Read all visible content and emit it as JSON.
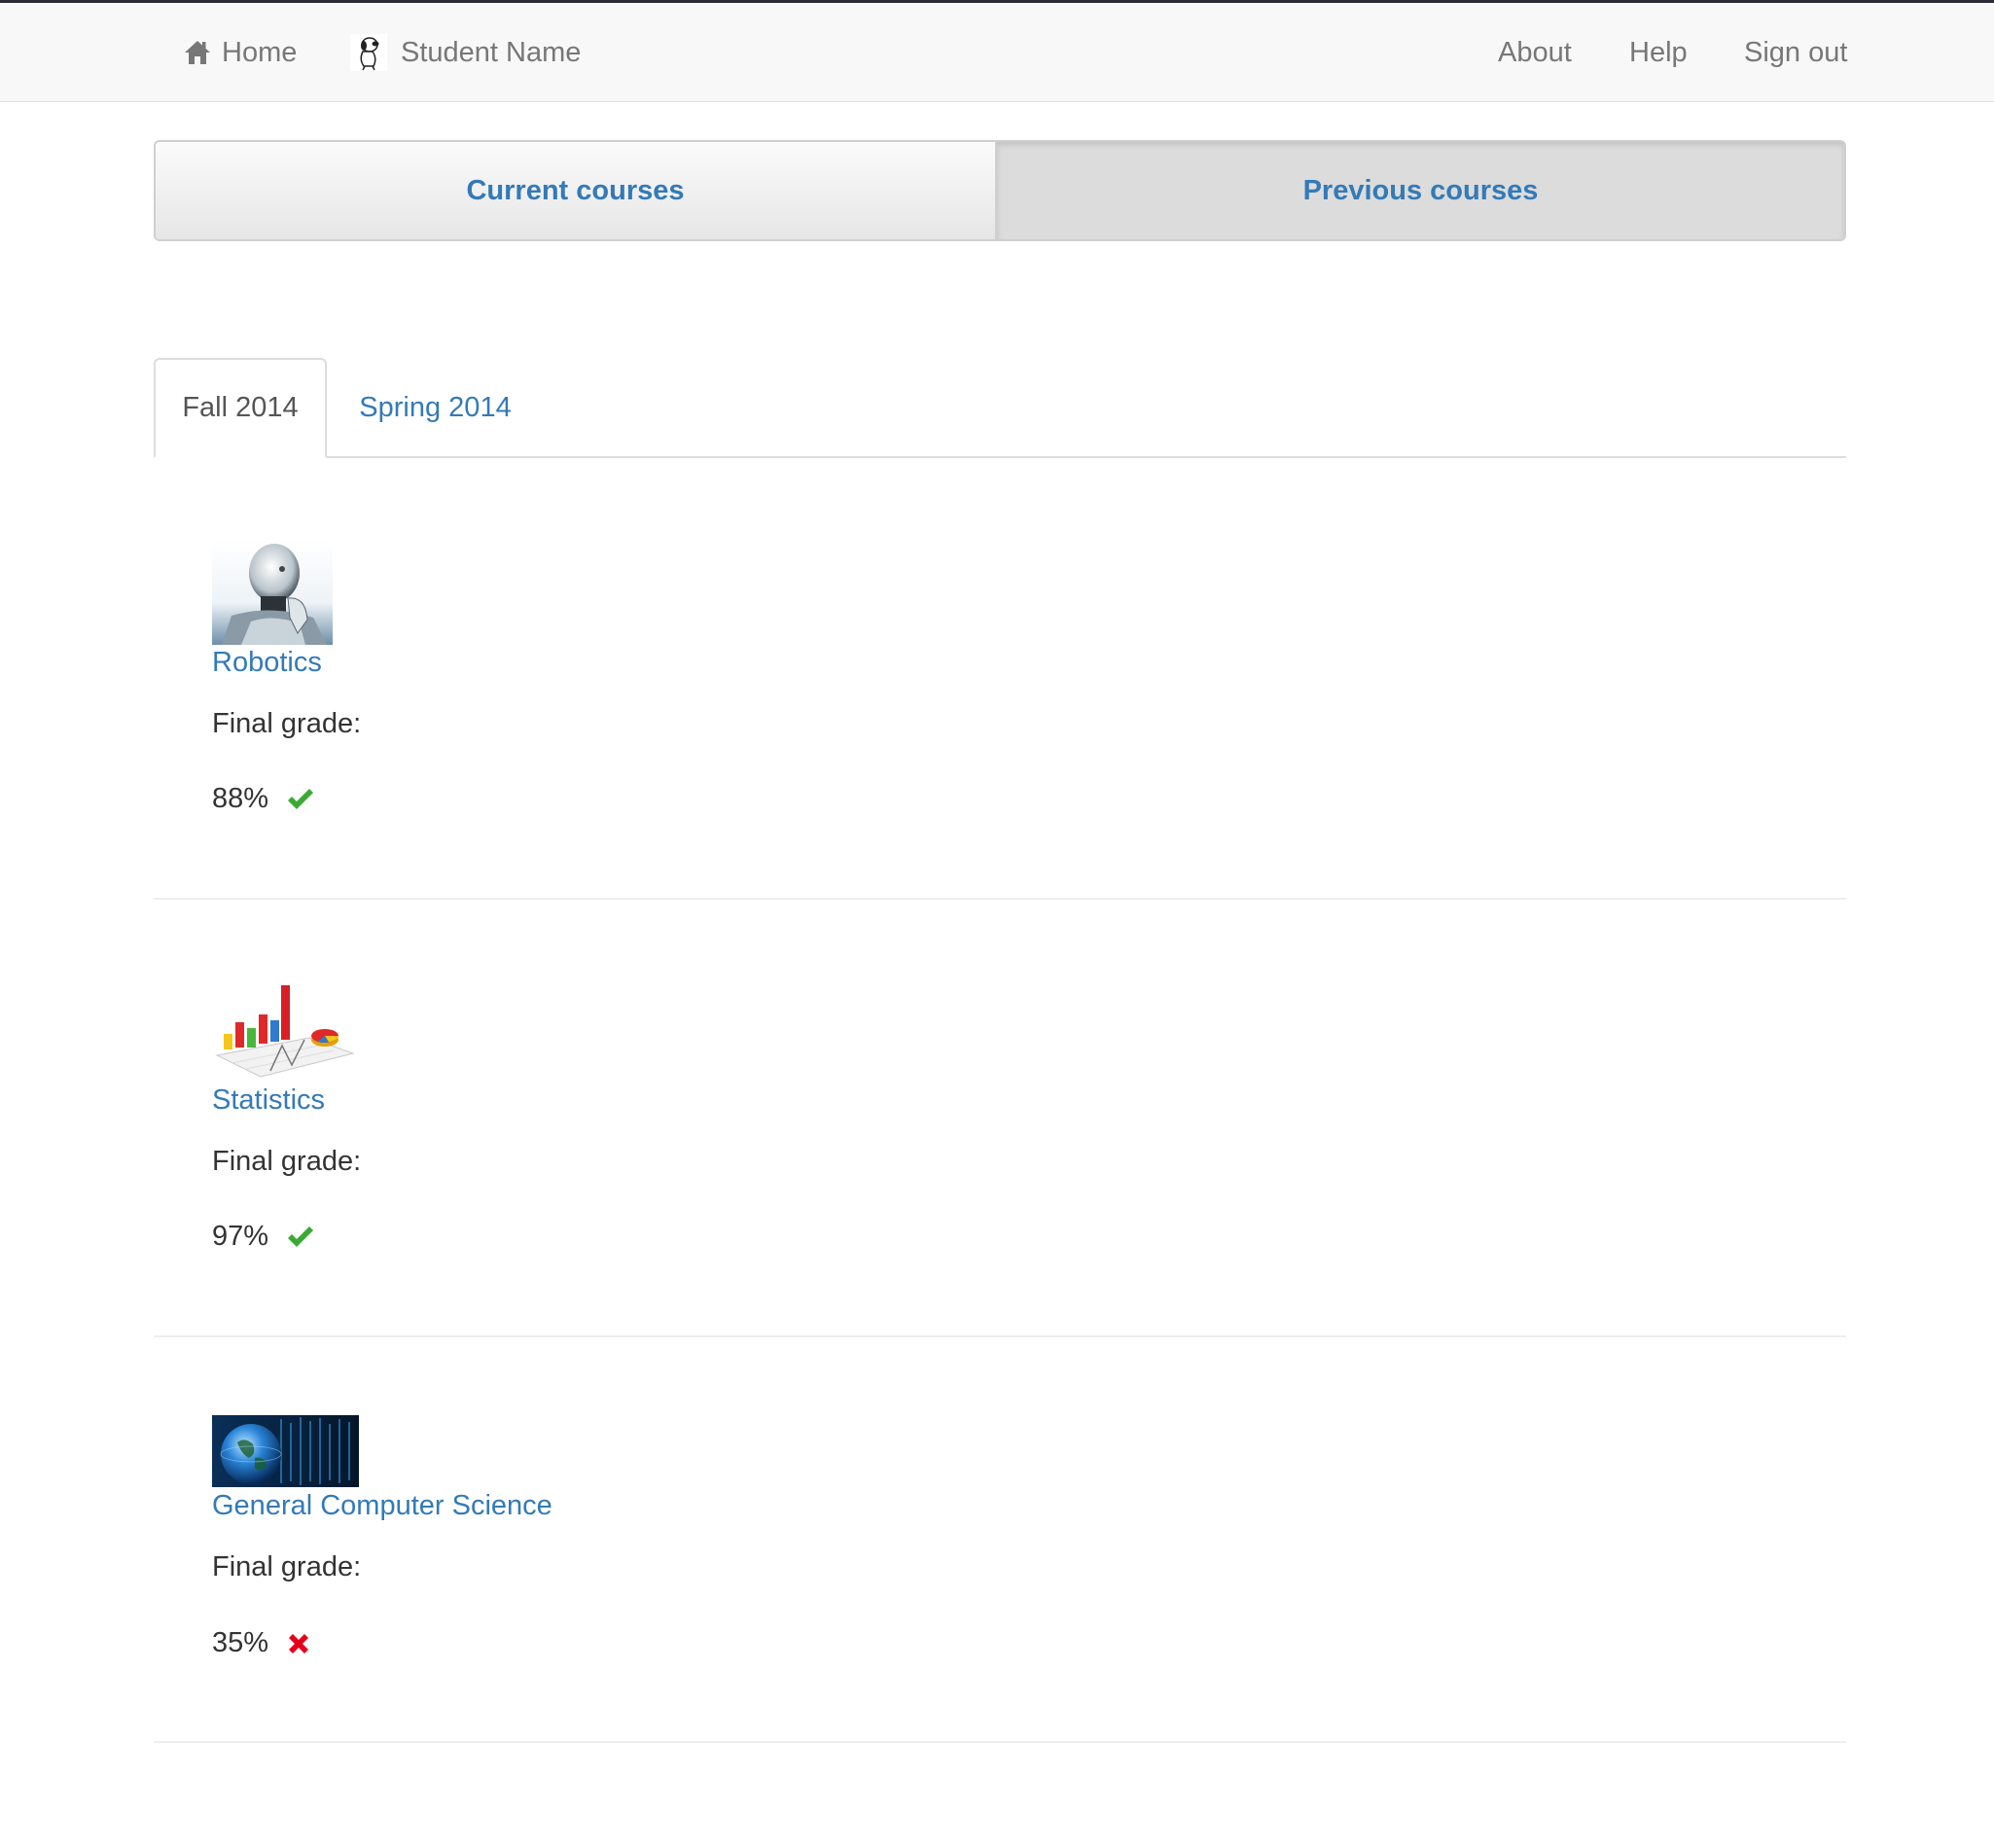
{
  "navbar": {
    "home_label": "Home",
    "user_name": "Student Name",
    "about_label": "About",
    "help_label": "Help",
    "signout_label": "Sign out"
  },
  "course_toggle": {
    "current_label": "Current courses",
    "previous_label": "Previous courses",
    "active": "Previous courses"
  },
  "term_tabs": {
    "active": "Fall 2014",
    "tabs": [
      {
        "label": "Fall 2014"
      },
      {
        "label": "Spring 2014"
      }
    ]
  },
  "courses": [
    {
      "title": "Robotics",
      "grade_label": "Final grade:",
      "grade": "88%",
      "status": "passed",
      "status_icon": "check-icon",
      "image": "robot-image"
    },
    {
      "title": "Statistics",
      "grade_label": "Final grade:",
      "grade": "97%",
      "status": "passed",
      "status_icon": "check-icon",
      "image": "chart-image"
    },
    {
      "title": "General Computer Science",
      "grade_label": "Final grade:",
      "grade": "35%",
      "status": "failed",
      "status_icon": "cross-icon",
      "image": "globe-image"
    }
  ],
  "colors": {
    "link": "#337ab7",
    "pass": "#3aaa35",
    "fail": "#e3001b",
    "navbar_bg": "#f8f8f8"
  }
}
